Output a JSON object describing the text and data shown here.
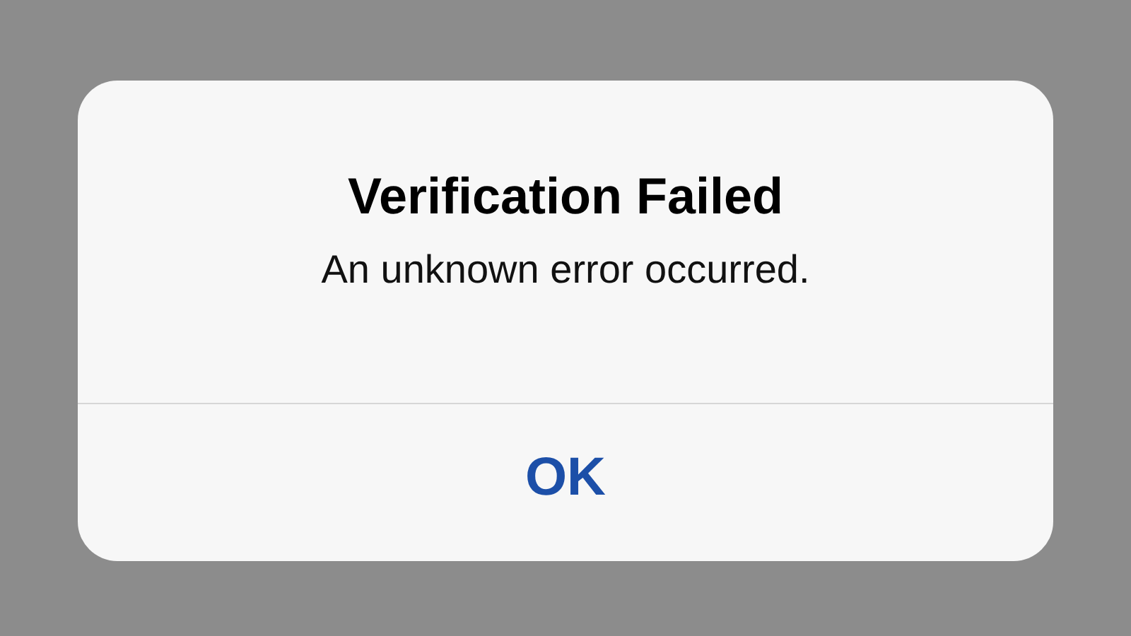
{
  "alert": {
    "title": "Verification Failed",
    "message": "An unknown error occurred.",
    "buttons": [
      "OK"
    ]
  }
}
